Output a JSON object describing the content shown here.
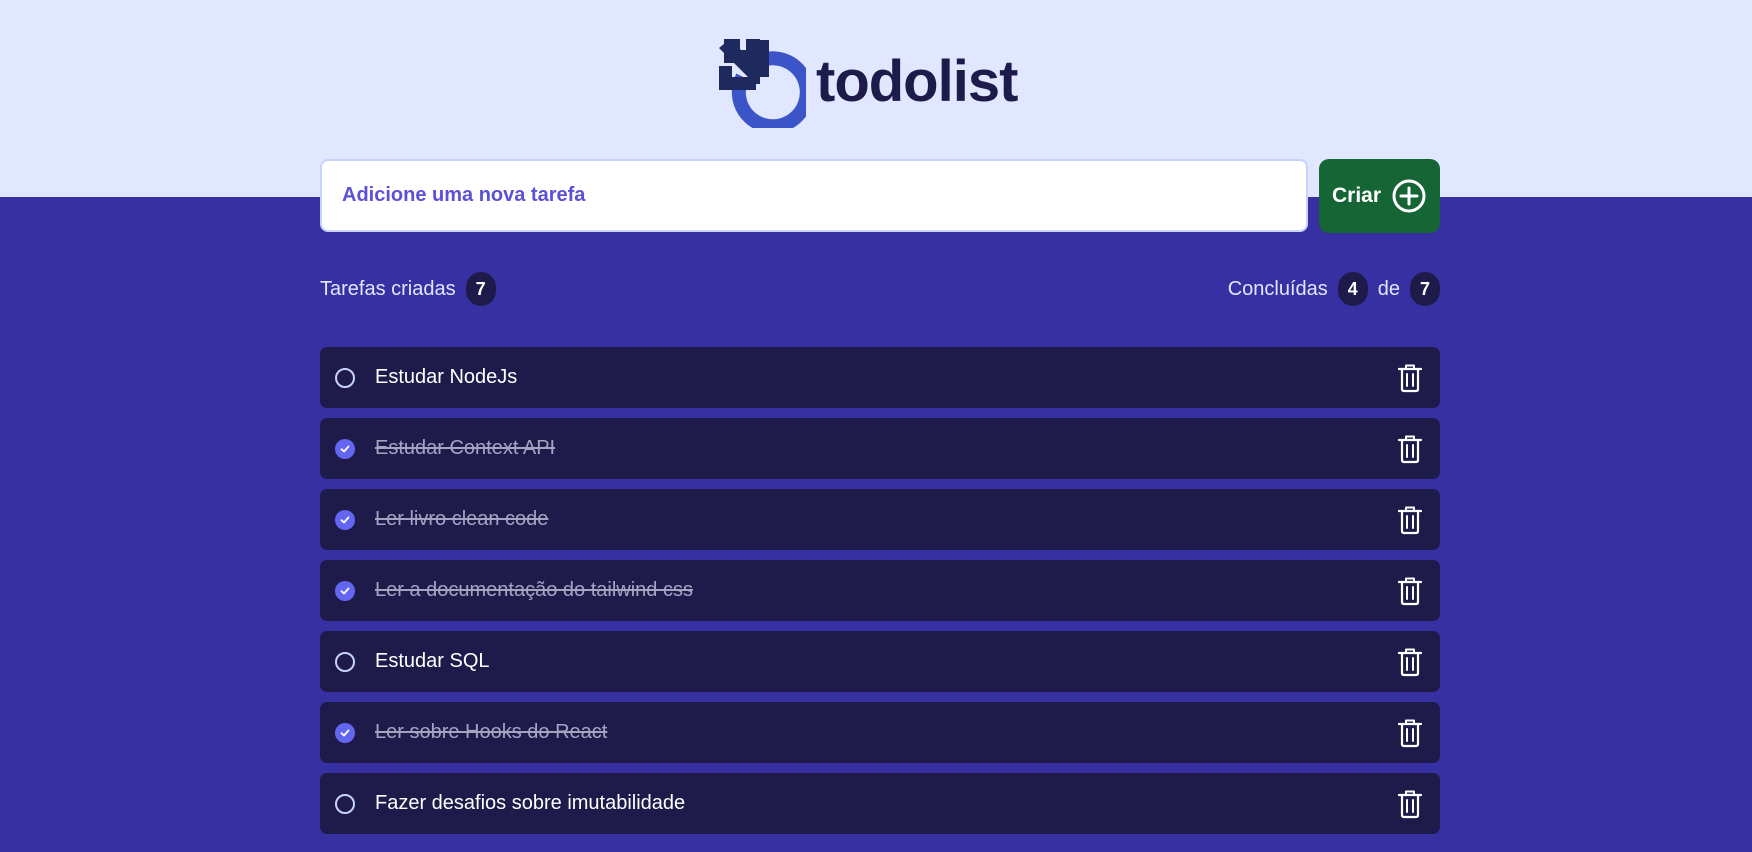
{
  "app": {
    "name": "todolist"
  },
  "logo": {
    "text": "todolist",
    "icon": "arrow-into-circle-icon"
  },
  "new_task": {
    "placeholder": "Adicione uma nova tarefa",
    "value": "",
    "button_label": "Criar",
    "button_icon": "plus-circle-icon"
  },
  "counters": {
    "created_label": "Tarefas criadas",
    "created_count": "7",
    "done_label": "Concluídas",
    "done_count": "4",
    "of_label": "de",
    "total_count": "7"
  },
  "tasks": [
    {
      "text": "Estudar NodeJs",
      "done": false
    },
    {
      "text": "Estudar Context API",
      "done": true
    },
    {
      "text": "Ler livro clean code",
      "done": true
    },
    {
      "text": "Ler a documentação do tailwind css",
      "done": true
    },
    {
      "text": "Estudar SQL",
      "done": false
    },
    {
      "text": "Ler sobre Hooks do React",
      "done": true
    },
    {
      "text": "Fazer desafios sobre imutabilidade",
      "done": false
    }
  ],
  "colors": {
    "background": "#3730a3",
    "header_background": "#e0e7ff",
    "card": "#1e1b4b",
    "create_button": "#166534",
    "check_done": "#6366f1",
    "logo_dark": "#1e1b4b",
    "logo_blue": "#3b55c8"
  }
}
